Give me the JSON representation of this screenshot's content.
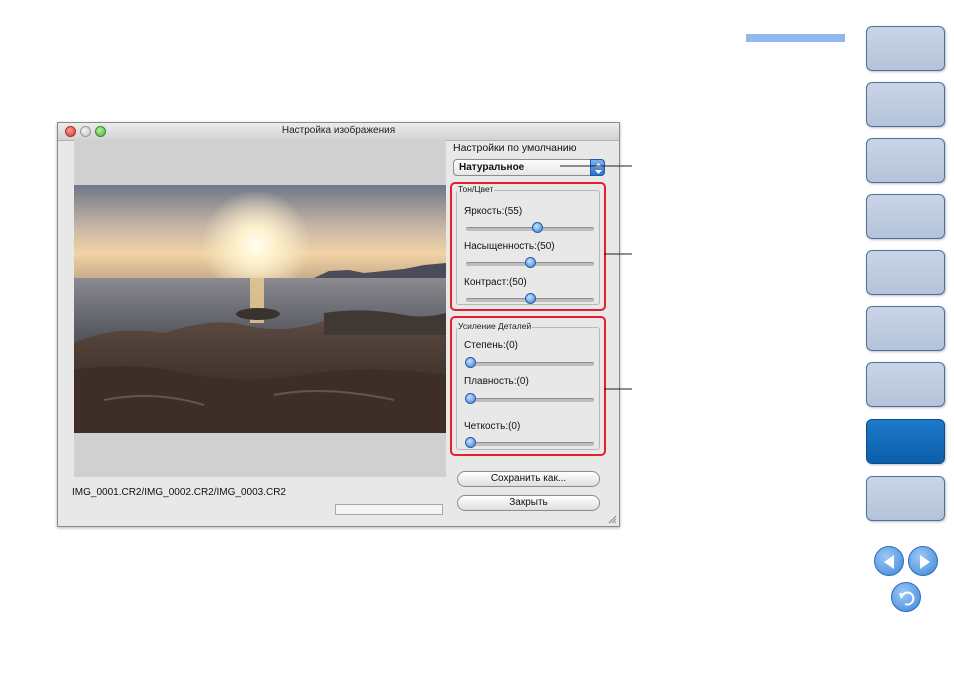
{
  "window": {
    "title": "Настройка изображения",
    "filenames": "IMG_0001.CR2/IMG_0002.CR2/IMG_0003.CR2"
  },
  "settings": {
    "heading": "Настройки по умолчанию",
    "style_value": "Натуральное"
  },
  "tone_color": {
    "title": "Тон/Цвет",
    "sliders": [
      {
        "label": "Яркость:(55)",
        "value": 55
      },
      {
        "label": "Насыщенность:(50)",
        "value": 50
      },
      {
        "label": "Контраст:(50)",
        "value": 50
      }
    ]
  },
  "detail": {
    "title": "Усиление Деталей",
    "sliders": [
      {
        "label": "Степень:(0)",
        "value": 0
      },
      {
        "label": "Плавность:(0)",
        "value": 0
      },
      {
        "label": "Четкость:(0)",
        "value": 0
      }
    ]
  },
  "buttons": {
    "save_as": "Сохранить как...",
    "close": "Закрыть"
  },
  "colors": {
    "accent": "#8fb8ef",
    "highlight_border": "#e41f2b",
    "nav_active": "#1d7acb"
  },
  "nav": {
    "tabs_count": 9,
    "active_tab_index": 7,
    "icons": [
      "prev-page-icon",
      "next-page-icon",
      "return-icon"
    ]
  }
}
